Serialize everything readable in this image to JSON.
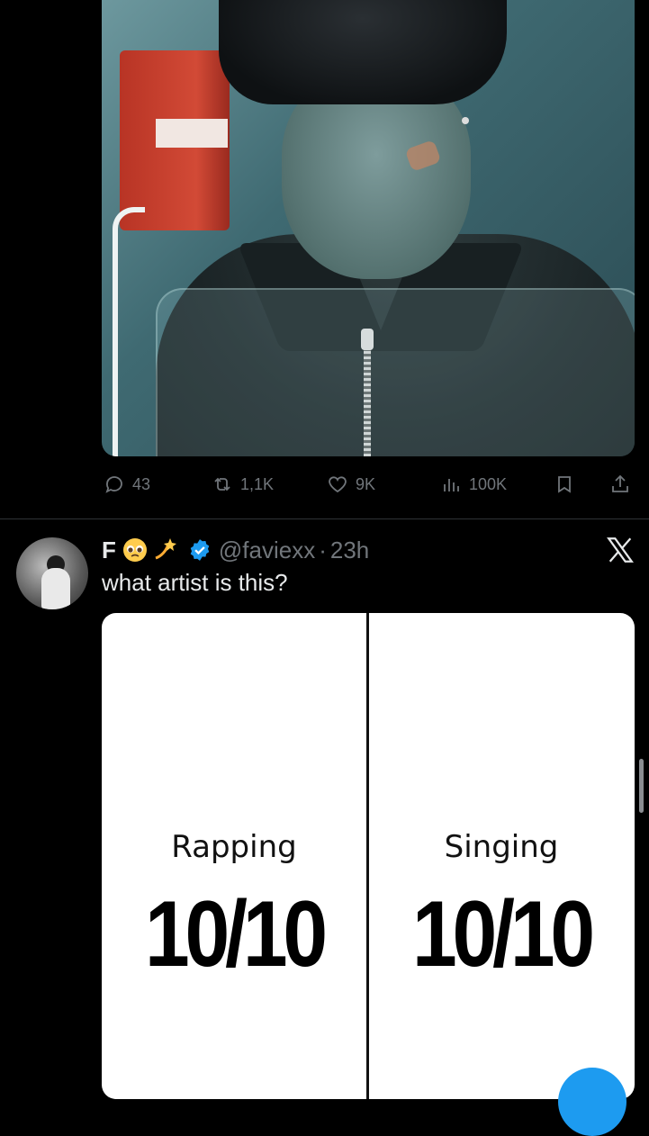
{
  "first_tweet": {
    "actions": {
      "replies": "43",
      "reposts": "1,1K",
      "likes": "9K",
      "views": "100K"
    }
  },
  "second_tweet": {
    "display_name": "F",
    "emojis": [
      "pleading-face",
      "dizzy"
    ],
    "handle": "@faviexx",
    "separator": "·",
    "time": "23h",
    "text": "what artist is this?",
    "media": {
      "left_label": "Rapping",
      "left_score": "10/10",
      "right_label": "Singing",
      "right_score": "10/10"
    }
  },
  "colors": {
    "background": "#000000",
    "muted": "#71767b",
    "text": "#e7e9ea",
    "accent": "#1d9bf0"
  }
}
